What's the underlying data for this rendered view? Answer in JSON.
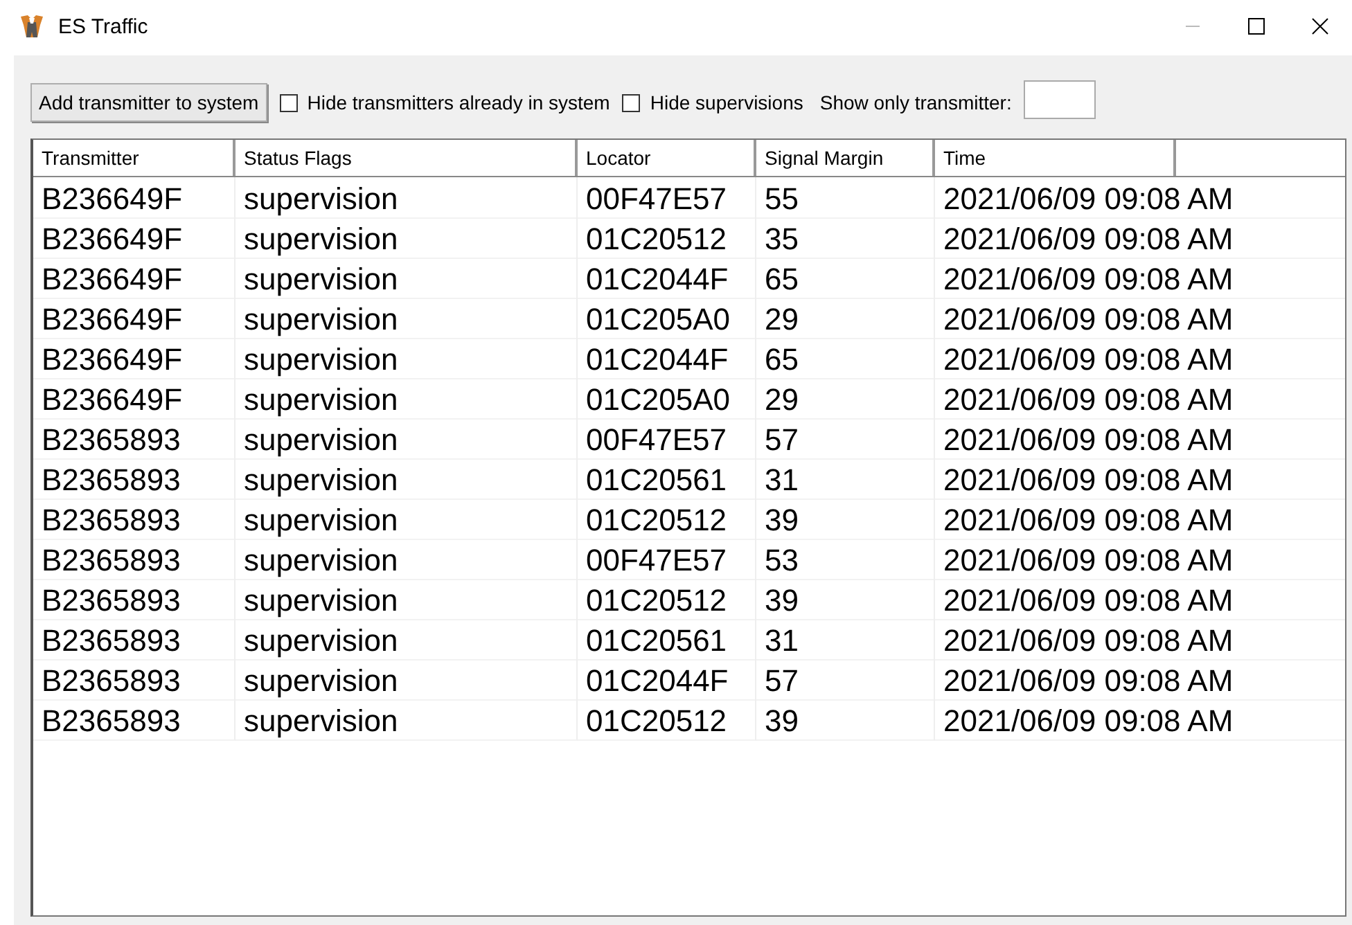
{
  "window": {
    "title": "ES Traffic"
  },
  "toolbar": {
    "button": "Add transmitter to system",
    "checkboxes": [
      {
        "label": "Hide transmitters already in system",
        "checked": false
      },
      {
        "label": "Hide supervisions",
        "checked": false
      }
    ],
    "filter": {
      "label": "Show only transmitter:"
    }
  },
  "table": {
    "columns": [
      "Transmitter",
      "Status Flags",
      "Locator",
      "Signal Margin",
      "Time"
    ],
    "rows": [
      [
        "B236649F",
        "supervision",
        "00F47E57",
        "55",
        "2021/06/09 09:08 AM"
      ],
      [
        "B236649F",
        "supervision",
        "01C20512",
        "35",
        "2021/06/09 09:08 AM"
      ],
      [
        "B236649F",
        "supervision",
        "01C2044F",
        "65",
        "2021/06/09 09:08 AM"
      ],
      [
        "B236649F",
        "supervision",
        "01C205A0",
        "29",
        "2021/06/09 09:08 AM"
      ],
      [
        "B236649F",
        "supervision",
        "01C2044F",
        "65",
        "2021/06/09 09:08 AM"
      ],
      [
        "B236649F",
        "supervision",
        "01C205A0",
        "29",
        "2021/06/09 09:08 AM"
      ],
      [
        "B2365893",
        "supervision",
        "00F47E57",
        "57",
        "2021/06/09 09:08 AM"
      ],
      [
        "B2365893",
        "supervision",
        "01C20561",
        "31",
        "2021/06/09 09:08 AM"
      ],
      [
        "B2365893",
        "supervision",
        "01C20512",
        "39",
        "2021/06/09 09:08 AM"
      ],
      [
        "B2365893",
        "supervision",
        "00F47E57",
        "53",
        "2021/06/09 09:08 AM"
      ],
      [
        "B2365893",
        "supervision",
        "01C20512",
        "39",
        "2021/06/09 09:08 AM"
      ],
      [
        "B2365893",
        "supervision",
        "01C20561",
        "31",
        "2021/06/09 09:08 AM"
      ],
      [
        "B2365893",
        "supervision",
        "01C2044F",
        "57",
        "2021/06/09 09:08 AM"
      ],
      [
        "B2365893",
        "supervision",
        "01C20512",
        "39",
        "2021/06/09 09:08 AM"
      ]
    ]
  }
}
